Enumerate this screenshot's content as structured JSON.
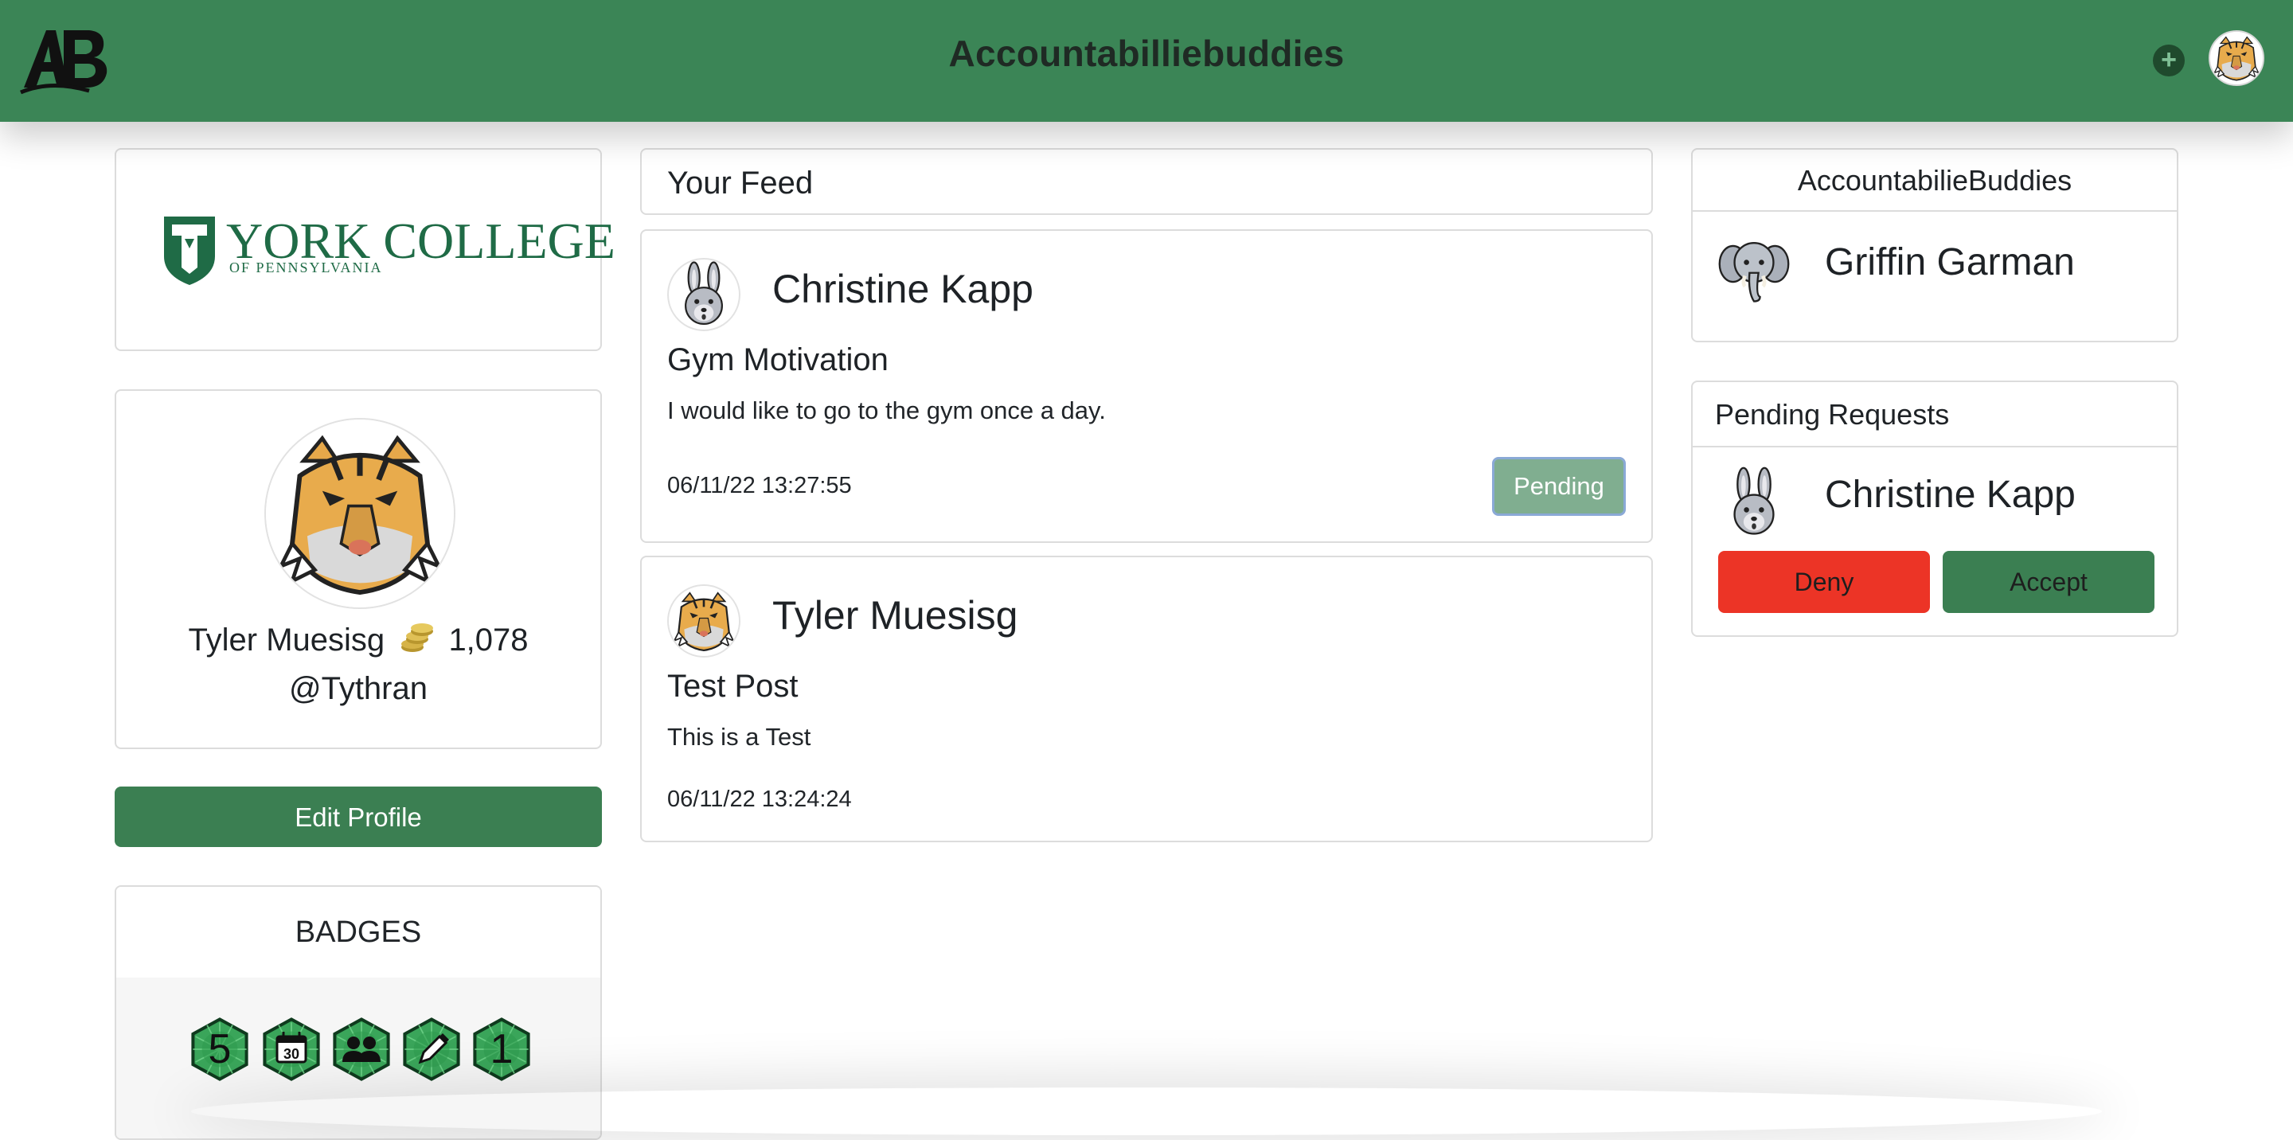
{
  "header": {
    "logo_text": "AB",
    "title": "Accountabilliebuddies",
    "add_icon": "plus-circle-icon",
    "avatar_icon": "tiger-avatar-icon"
  },
  "left": {
    "college_logo": {
      "name": "YORK COLLEGE",
      "subtitle": "OF PENNSYLVANIA",
      "color": "#1f6b46"
    },
    "profile": {
      "name": "Tyler Muesisg",
      "coins": "1,078",
      "coin_icon": "coins-icon",
      "handle": "@Tythran"
    },
    "edit_profile_label": "Edit Profile",
    "badges": {
      "title": "BADGES",
      "items": [
        {
          "icon": "number-5-badge-icon",
          "label": "5"
        },
        {
          "icon": "calendar-30-badge-icon",
          "label": "30"
        },
        {
          "icon": "friends-badge-icon",
          "label": ""
        },
        {
          "icon": "pencil-badge-icon",
          "label": ""
        },
        {
          "icon": "number-1-badge-icon",
          "label": "1"
        }
      ]
    }
  },
  "feed": {
    "title": "Your Feed",
    "posts": [
      {
        "author": "Christine Kapp",
        "avatar_icon": "rabbit-avatar-icon",
        "title": "Gym Motivation",
        "body": "I would like to go to the gym once a day.",
        "timestamp": "06/11/22 13:27:55",
        "status_label": "Pending"
      },
      {
        "author": "Tyler Muesisg",
        "avatar_icon": "tiger-avatar-icon",
        "title": "Test Post",
        "body": "This is a Test",
        "timestamp": "06/11/22 13:24:24"
      }
    ]
  },
  "right": {
    "buddies": {
      "title": "AccountabilieBuddies",
      "items": [
        {
          "name": "Griffin Garman",
          "avatar_icon": "elephant-avatar-icon"
        }
      ]
    },
    "pending": {
      "title": "Pending Requests",
      "items": [
        {
          "name": "Christine Kapp",
          "avatar_icon": "rabbit-avatar-icon"
        }
      ],
      "deny_label": "Deny",
      "accept_label": "Accept"
    }
  },
  "colors": {
    "brand_green": "#3b8556",
    "button_green": "#3b7f52",
    "deny_red": "#ec3426",
    "pending_green": "#80ae90"
  }
}
